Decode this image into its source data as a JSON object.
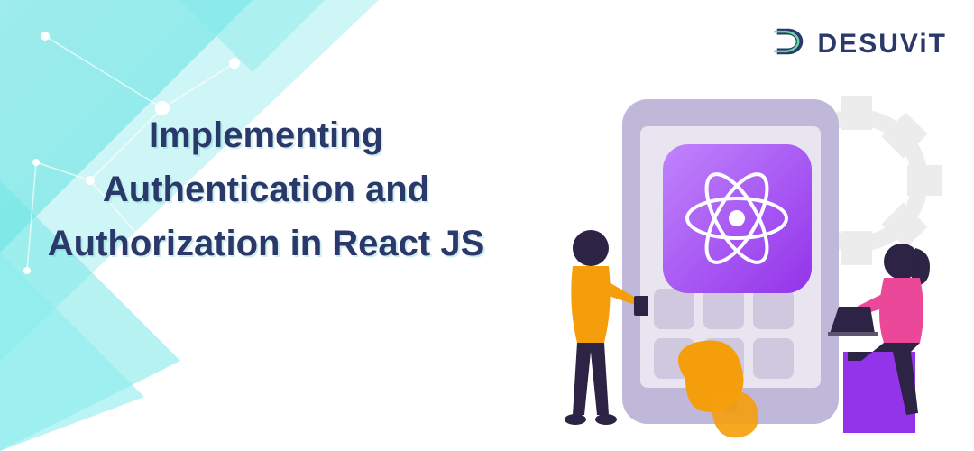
{
  "title": "Implementing Authentication and Authorization in React JS",
  "logo": {
    "brand": "DESUViT",
    "icon_name": "desuvit-logo-icon"
  },
  "illustration": {
    "name": "react-developers-illustration",
    "elements": [
      "tablet-device",
      "react-logo",
      "gear",
      "person-standing",
      "person-sitting-laptop"
    ]
  },
  "colors": {
    "title_color": "#2a3969",
    "accent_cyan": "#5ce0e0",
    "react_purple": "#a855f7",
    "react_logo": "#ffffff"
  }
}
